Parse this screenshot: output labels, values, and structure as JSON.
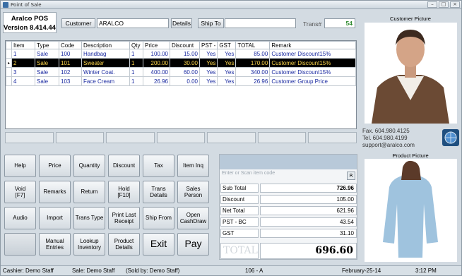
{
  "window": {
    "title": "Point of Sale"
  },
  "logo": {
    "line1": "Aralco POS",
    "line2": "Version 8.414.44"
  },
  "header": {
    "customer_label": "Customer",
    "customer_value": "ARALCO",
    "details_label": "Details",
    "ship_to_label": "Ship To",
    "ship_to_value": "",
    "trans_label": "Trans#",
    "trans_value": "54"
  },
  "grid": {
    "columns": [
      "Item",
      "Type",
      "Code",
      "Description",
      "Qty",
      "Price",
      "Discount",
      "PST",
      "-",
      "GST",
      "TOTAL",
      "Remark"
    ],
    "rows": [
      {
        "item": "1",
        "type": "Sale",
        "code": "100",
        "description": "Handbag",
        "qty": "1",
        "price": "100.00",
        "discount": "15.00",
        "pst": "Yes",
        "gst": "Yes",
        "total": "85.00",
        "remark": "Customer Discount15%"
      },
      {
        "item": "2",
        "type": "Sale",
        "code": "101",
        "description": "Sweater",
        "qty": "1",
        "price": "200.00",
        "discount": "30.00",
        "pst": "Yes",
        "gst": "Yes",
        "total": "170.00",
        "remark": "Customer Discount15%"
      },
      {
        "item": "3",
        "type": "Sale",
        "code": "102",
        "description": "Winter Coat.",
        "qty": "1",
        "price": "400.00",
        "discount": "60.00",
        "pst": "Yes",
        "gst": "Yes",
        "total": "340.00",
        "remark": "Customer Discount15%"
      },
      {
        "item": "4",
        "type": "Sale",
        "code": "103",
        "description": "Face Cream",
        "qty": "1",
        "price": "26.96",
        "discount": "0.00",
        "pst": "Yes",
        "gst": "Yes",
        "total": "26.96",
        "remark": "Customer Group Price"
      }
    ],
    "selected_row_marker": "▸"
  },
  "buttons": [
    {
      "name": "help-button",
      "label": "Help"
    },
    {
      "name": "price-button",
      "label": "Price"
    },
    {
      "name": "quantity-button",
      "label": "Quantity"
    },
    {
      "name": "discount-button",
      "label": "Discount"
    },
    {
      "name": "tax-button",
      "label": "Tax"
    },
    {
      "name": "item-inq-button",
      "label": "Item Inq"
    },
    {
      "name": "void-button",
      "label": "Void",
      "sub": "[F7]"
    },
    {
      "name": "remarks-button",
      "label": "Remarks"
    },
    {
      "name": "return-button",
      "label": "Return"
    },
    {
      "name": "hold-button",
      "label": "Hold",
      "sub": "[F10]"
    },
    {
      "name": "trans-details-button",
      "label": "Trans",
      "sub": "Details"
    },
    {
      "name": "sales-person-button",
      "label": "Sales",
      "sub": "Person"
    },
    {
      "name": "audio-button",
      "label": "Audio"
    },
    {
      "name": "import-button",
      "label": "Import"
    },
    {
      "name": "trans-type-button",
      "label": "Trans Type"
    },
    {
      "name": "print-last-receipt-button",
      "label": "Print Last",
      "sub": "Receipt"
    },
    {
      "name": "ship-from-button",
      "label": "Ship From"
    },
    {
      "name": "open-cashdraw-button",
      "label": "Open",
      "sub": "CashDraw"
    },
    {
      "name": "blank-button",
      "label": ""
    },
    {
      "name": "manual-entries-button",
      "label": "Manual",
      "sub": "Entries"
    },
    {
      "name": "lookup-inventory-button",
      "label": "Lookup",
      "sub": "Inventory"
    },
    {
      "name": "product-details-button",
      "label": "Product",
      "sub": "Details"
    },
    {
      "name": "exit-button",
      "label": "Exit"
    },
    {
      "name": "pay-button",
      "label": "Pay"
    }
  ],
  "scan": {
    "placeholder": "Enter or Scan item code",
    "r_label": "R"
  },
  "totals": [
    {
      "label": "Sub Total",
      "value": "726.96"
    },
    {
      "label": "Discount",
      "value": "105.00"
    },
    {
      "label": "Net Total",
      "value": "621.96"
    },
    {
      "label": "PST  - BC",
      "value": "43.54"
    },
    {
      "label": "GST",
      "value": "31.10"
    }
  ],
  "grand_total": {
    "label": "TOTAL",
    "value": "696.60"
  },
  "right_panel": {
    "customer_picture_label": "Customer Picture",
    "product_picture_label": "Product Picture",
    "fax": "Fax.   604.980.4125",
    "tel": "Tel.   604.980.4199",
    "email": "support@aralco.com"
  },
  "status": {
    "cashier": "Cashier: Demo Staff",
    "sale": "Sale: Demo Staff",
    "sold_by": "(Sold by: Demo Staff)",
    "station": "106 - A",
    "date": "February-25-14",
    "time": "3:12 PM"
  }
}
